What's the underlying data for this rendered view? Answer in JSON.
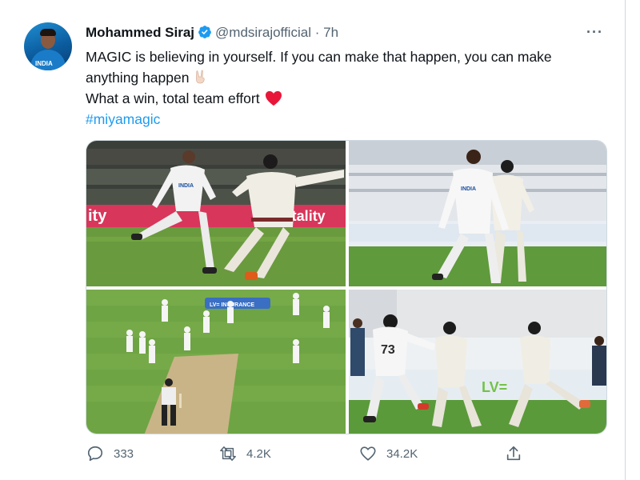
{
  "tweet": {
    "author_name": "Mohammed Siraj",
    "handle": "@mdsirajofficial",
    "separator": "·",
    "time": "7h",
    "more": "···",
    "lines": [
      "MAGIC is believing in yourself. If you can make that happen, you can make",
      "anything happen",
      "What a win, total team effort"
    ],
    "hashtag": "#miyamagic",
    "avatar_text": "INDIA"
  },
  "actions": {
    "replies": "333",
    "retweets": "4.2K",
    "likes": "34.2K"
  },
  "images": [
    {
      "board_left": "ity",
      "board_right": "Vitality",
      "jersey": "INDIA"
    },
    {
      "jersey": "INDIA"
    },
    {
      "board": "LV= INSURANCE"
    },
    {
      "jersey_number": "73",
      "board": "LV="
    }
  ],
  "colors": {
    "link": "#1d9bf0",
    "muted": "#536471",
    "heart": "#f4212e",
    "verified": "#1d9bf0"
  }
}
